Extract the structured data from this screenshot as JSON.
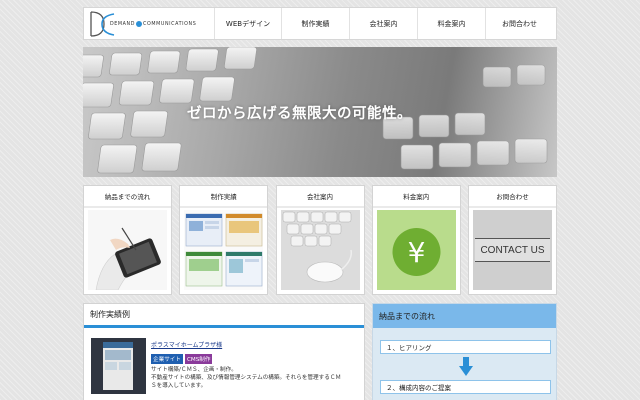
{
  "logo": {
    "text_left": "DEMAND",
    "text_right": "COMMUNICATIONS",
    "accent": "#2a8fd6"
  },
  "nav": {
    "items": [
      "WEBデザイン",
      "制作実績",
      "会社案内",
      "料金案内",
      "お問合わせ"
    ]
  },
  "hero": {
    "headline": "ゼロから広げる無限大の可能性。"
  },
  "cards": [
    {
      "title": "納品までの流れ",
      "icon": "tablet-hand-photo"
    },
    {
      "title": "制作実績",
      "icon": "website-thumbnails"
    },
    {
      "title": "会社案内",
      "icon": "keyboard-mouse-photo"
    },
    {
      "title": "料金案内",
      "icon": "yen-icon"
    },
    {
      "title": "お問合わせ",
      "icon": "contact-us-sign",
      "sign_text": "CONTACT US"
    }
  ],
  "works": {
    "title": "制作実績例",
    "item": {
      "link": "ポラスマイホームプラザ様",
      "tags": [
        "企業サイト",
        "CMS制作"
      ],
      "desc_lines": [
        "サイト構築/ＣＭＳ、企画・制作。",
        "不動産サイトの構築、及び情報管理システムの構築。それらを管理するＣＭ",
        "Ｓを導入しています。"
      ]
    }
  },
  "flow": {
    "title": "納品までの流れ",
    "steps": [
      "１、ヒアリング",
      "２、構成内容のご提案"
    ]
  },
  "colors": {
    "accent_blue": "#2a8fd6",
    "flow_header": "#7ab8ea",
    "tag_blue": "#1f5fb0",
    "tag_purple": "#8a3a9a",
    "yen_green": "#6fae32"
  }
}
